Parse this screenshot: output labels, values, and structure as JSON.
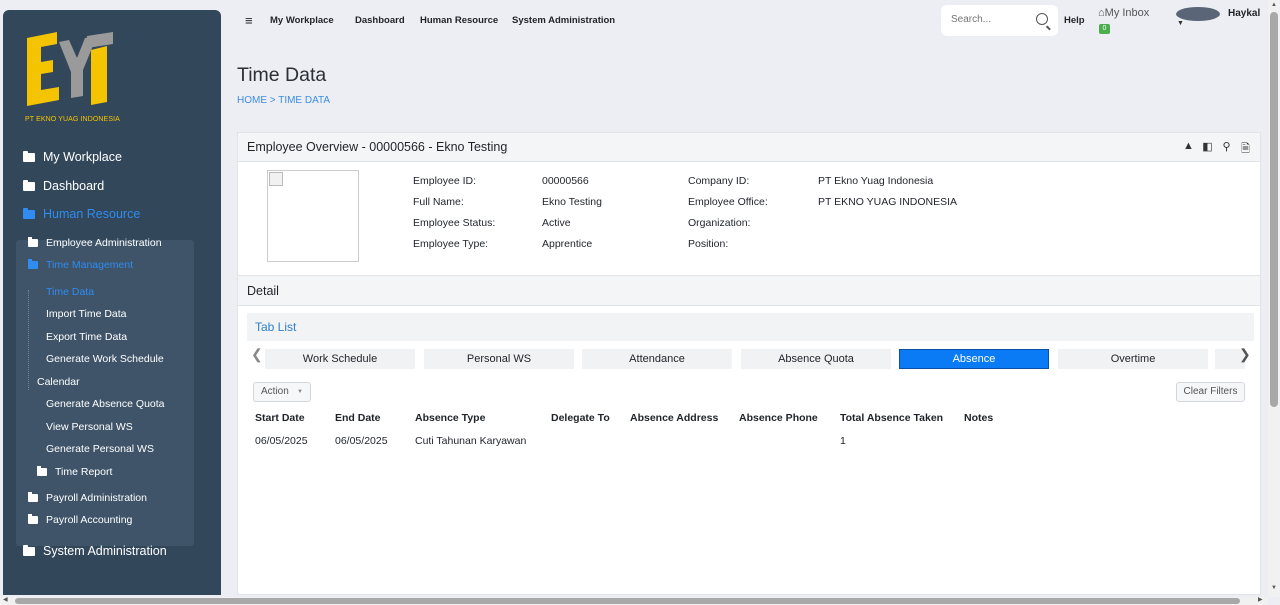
{
  "sidebar": {
    "logo_subtitle": "PT EKNO YUAG INDONESIA",
    "items": [
      {
        "label": "My Workplace"
      },
      {
        "label": "Dashboard"
      },
      {
        "label": "Human Resource"
      },
      {
        "label": "System Administration"
      }
    ],
    "sub_items": [
      {
        "label": "Employee Administration"
      },
      {
        "label": "Time Management"
      },
      {
        "label": "Time Data"
      },
      {
        "label": "Import Time Data"
      },
      {
        "label": "Export Time Data"
      },
      {
        "label": "Generate Work Schedule"
      },
      {
        "label": "Calendar"
      },
      {
        "label": "Generate Absence Quota"
      },
      {
        "label": "View Personal WS"
      },
      {
        "label": "Generate Personal WS"
      },
      {
        "label": "Time Report"
      },
      {
        "label": "Payroll Administration"
      },
      {
        "label": "Payroll Accounting"
      }
    ]
  },
  "topbar": {
    "nav": [
      "My Workplace",
      "Dashboard",
      "Human Resource",
      "System Administration"
    ],
    "search_placeholder": "Search...",
    "help": "Help",
    "inbox": "My Inbox",
    "inbox_count": "0",
    "user": "Haykal"
  },
  "page": {
    "title": "Time Data",
    "breadcrumb": "HOME > TIME DATA"
  },
  "overview": {
    "title": "Employee Overview - 00000566 - Ekno Testing",
    "fields": [
      {
        "label": "Employee ID:",
        "value": "00000566"
      },
      {
        "label": "Full Name:",
        "value": "Ekno Testing"
      },
      {
        "label": "Employee Status:",
        "value": "Active"
      },
      {
        "label": "Employee Type:",
        "value": "Apprentice"
      },
      {
        "label": "Company ID:",
        "value": "PT Ekno Yuag Indonesia"
      },
      {
        "label": "Employee Office:",
        "value": "PT EKNO YUAG INDONESIA"
      },
      {
        "label": "Organization:",
        "value": ""
      },
      {
        "label": "Position:",
        "value": ""
      }
    ]
  },
  "detail": {
    "title": "Detail",
    "tab_list_title": "Tab List",
    "tabs": [
      "Work Schedule",
      "Personal WS",
      "Attendance",
      "Absence Quota",
      "Absence",
      "Overtime"
    ],
    "active_tab": "Absence",
    "action_label": "Action",
    "clear_filters": "Clear Filters",
    "columns": [
      "Start Date",
      "End Date",
      "Absence Type",
      "Delegate To",
      "Absence Address",
      "Absence Phone",
      "Total Absence Taken",
      "Notes"
    ],
    "rows": [
      [
        "06/05/2025",
        "06/05/2025",
        "Cuti Tahunan Karyawan",
        "",
        "",
        "",
        "1",
        ""
      ]
    ]
  },
  "colors": {
    "sidebar": "#33475b",
    "accent": "#0a7bf5",
    "logo": "#f5c400"
  }
}
